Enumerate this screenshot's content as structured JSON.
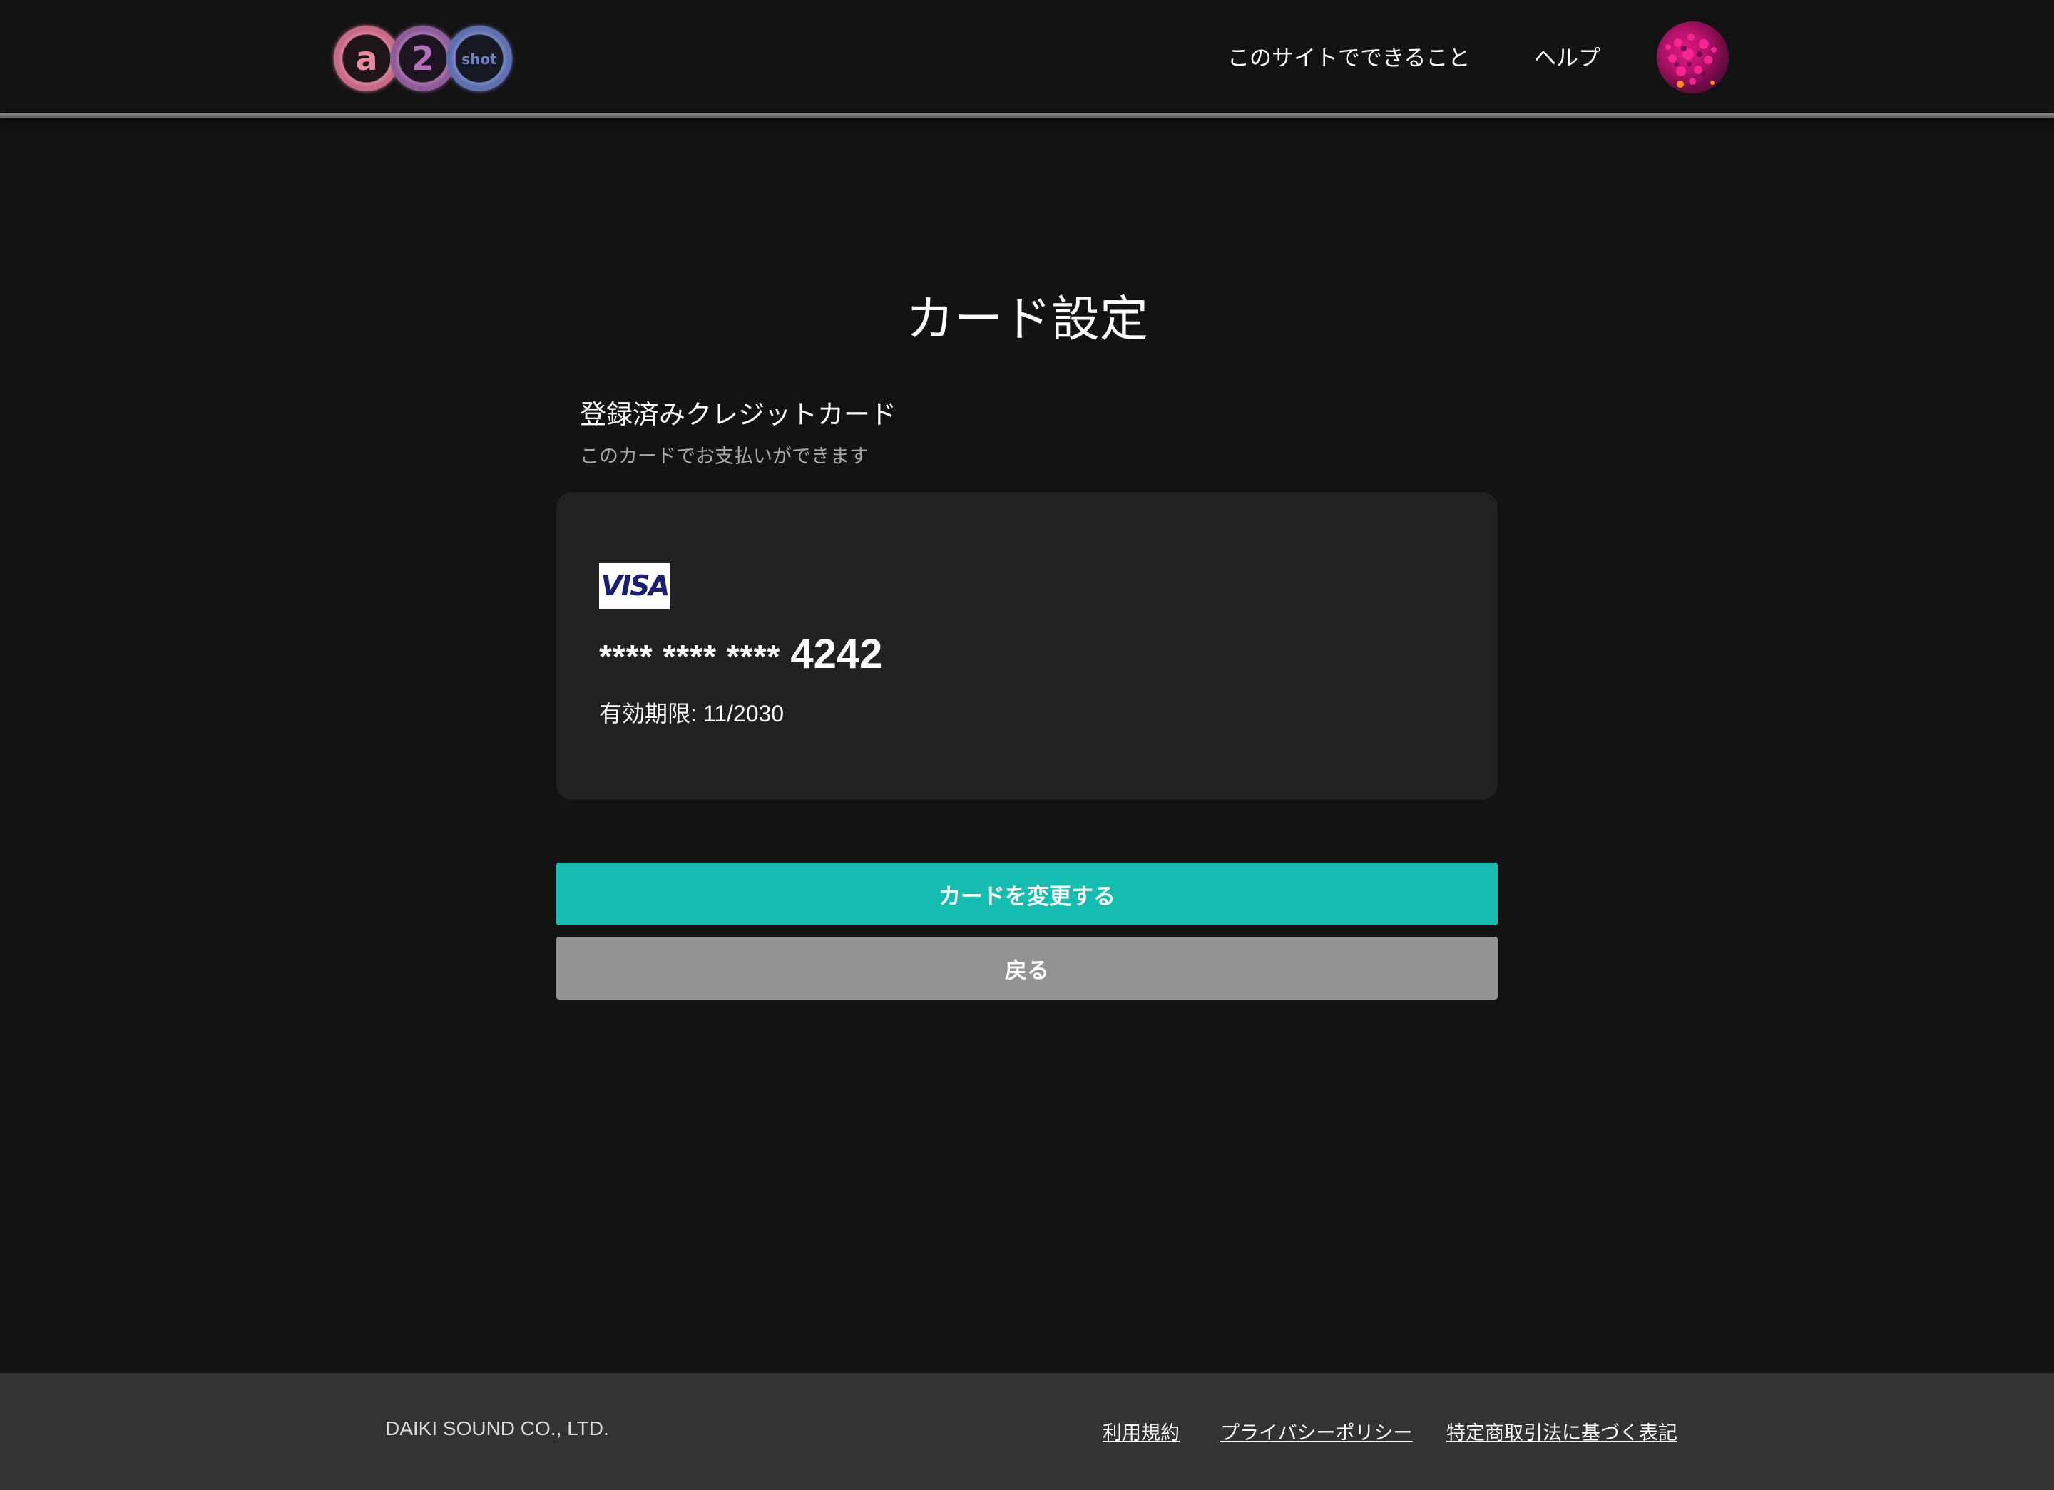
{
  "header": {
    "logo_alt": "a2shot",
    "logo_letters": [
      "a",
      "2",
      "shot"
    ],
    "nav": {
      "what_you_can_do": "このサイトでできること",
      "help": "ヘルプ"
    },
    "avatar_icon": "user-avatar-icon"
  },
  "main": {
    "title": "カード設定",
    "section_title": "登録済みクレジットカード",
    "section_subtitle": "このカードでお支払いができます",
    "card": {
      "brand": "VISA",
      "brand_color": "#1a1f71",
      "masked_number": "**** **** ****",
      "last4": "4242",
      "expiry": "有効期限: 11/2030"
    },
    "buttons": {
      "change_card": "カードを変更する",
      "back": "戻る"
    },
    "colors": {
      "primary": "#14bdb0",
      "secondary": "#939393",
      "background": "#131313",
      "panel": "#212121"
    }
  },
  "footer": {
    "company": "DAIKI SOUND CO., LTD.",
    "links": {
      "terms": "利用規約",
      "privacy": "プライバシーポリシー",
      "sct": "特定商取引法に基づく表記"
    }
  }
}
